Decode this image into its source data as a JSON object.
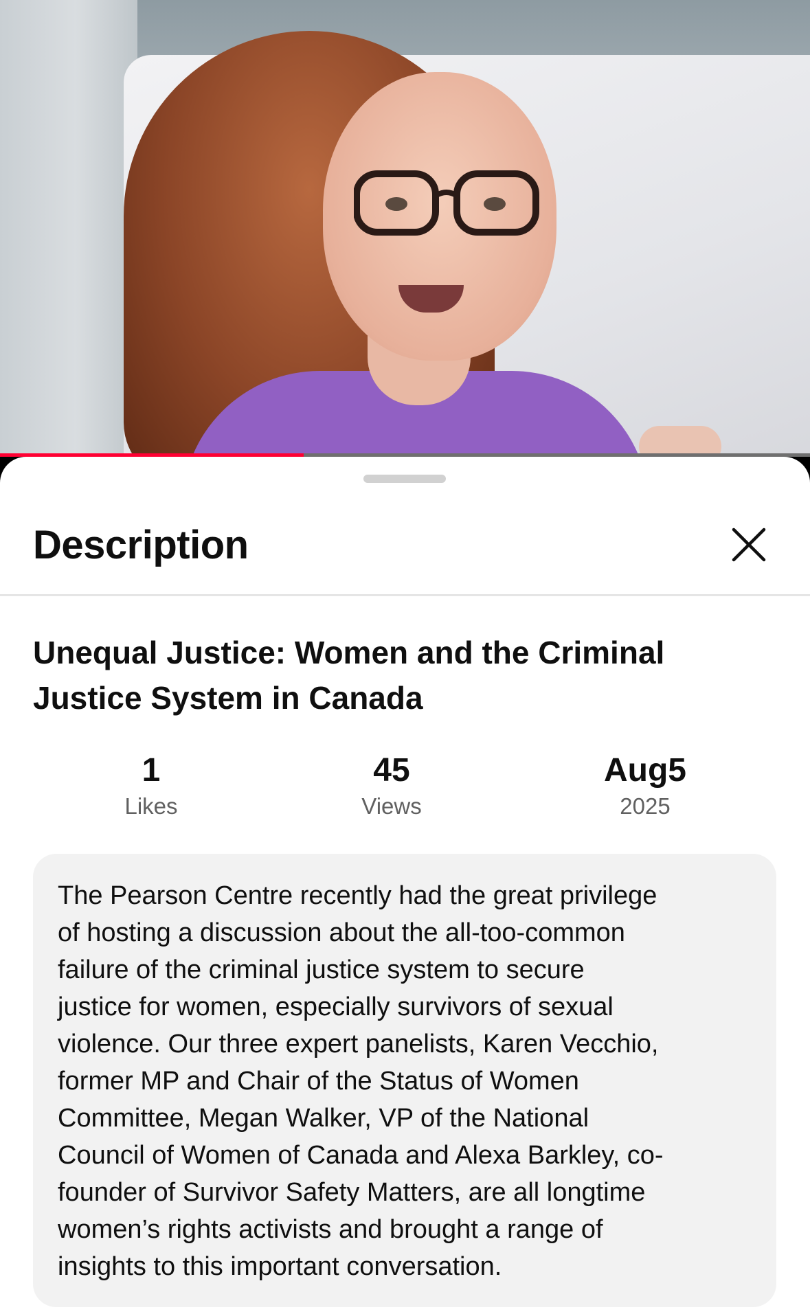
{
  "video": {
    "progress_fraction": 0.375,
    "progress_color": "#ff0033"
  },
  "sheet": {
    "title": "Description",
    "close_icon": "close-icon"
  },
  "video_info": {
    "title": "Unequal Justice:  Women and the Criminal Justice System in Canada",
    "stats": [
      {
        "value": "1",
        "label": "Likes"
      },
      {
        "value": "45",
        "label": "Views"
      },
      {
        "value": "Aug5",
        "label": "2025"
      }
    ],
    "description": "The Pearson Centre recently had the great privilege\nof hosting a discussion about the all-too-common\nfailure of the criminal justice system to secure\njustice for  women, especially survivors of sexual\nviolence. Our three expert panelists, Karen Vecchio,\nformer MP and Chair of the Status of Women\nCommittee, Megan Walker, VP of the National\nCouncil of Women of Canada and Alexa Barkley, co-\nfounder of Survivor Safety Matters, are all longtime\nwomen’s rights activists and brought a range of\ninsights to this important conversation."
  }
}
